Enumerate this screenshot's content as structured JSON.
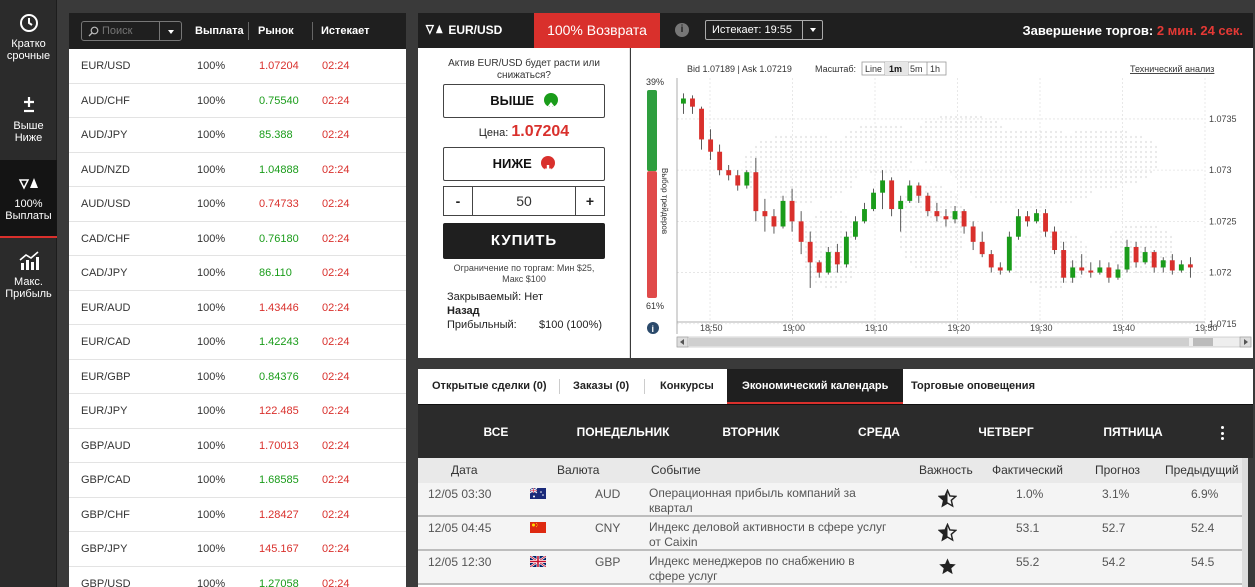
{
  "nav": [
    {
      "label": "Кратко срочные",
      "icon": "clock-icon"
    },
    {
      "label": "Выше Ниже",
      "icon": "plus-minus-icon"
    },
    {
      "label": "100% Выплаты",
      "icon": "up-down-arrows-icon"
    },
    {
      "label": "Макс. Прибыль",
      "icon": "chart-growth-icon"
    }
  ],
  "market": {
    "search_placeholder": "Поиск",
    "headers": {
      "payout": "Выплата",
      "market": "Рынок",
      "expires": "Истекает"
    },
    "rows": [
      {
        "symbol": "EUR/USD",
        "payout": "100%",
        "price": "1.07204",
        "dir": "down",
        "expires": "02:24"
      },
      {
        "symbol": "AUD/CHF",
        "payout": "100%",
        "price": "0.75540",
        "dir": "up",
        "expires": "02:24"
      },
      {
        "symbol": "AUD/JPY",
        "payout": "100%",
        "price": "85.388",
        "dir": "up",
        "expires": "02:24"
      },
      {
        "symbol": "AUD/NZD",
        "payout": "100%",
        "price": "1.04888",
        "dir": "up",
        "expires": "02:24"
      },
      {
        "symbol": "AUD/USD",
        "payout": "100%",
        "price": "0.74733",
        "dir": "down",
        "expires": "02:24"
      },
      {
        "symbol": "CAD/CHF",
        "payout": "100%",
        "price": "0.76180",
        "dir": "up",
        "expires": "02:24"
      },
      {
        "symbol": "CAD/JPY",
        "payout": "100%",
        "price": "86.110",
        "dir": "up",
        "expires": "02:24"
      },
      {
        "symbol": "EUR/AUD",
        "payout": "100%",
        "price": "1.43446",
        "dir": "down",
        "expires": "02:24"
      },
      {
        "symbol": "EUR/CAD",
        "payout": "100%",
        "price": "1.42243",
        "dir": "up",
        "expires": "02:24"
      },
      {
        "symbol": "EUR/GBP",
        "payout": "100%",
        "price": "0.84376",
        "dir": "up",
        "expires": "02:24"
      },
      {
        "symbol": "EUR/JPY",
        "payout": "100%",
        "price": "122.485",
        "dir": "down",
        "expires": "02:24"
      },
      {
        "symbol": "GBP/AUD",
        "payout": "100%",
        "price": "1.70013",
        "dir": "down",
        "expires": "02:24"
      },
      {
        "symbol": "GBP/CAD",
        "payout": "100%",
        "price": "1.68585",
        "dir": "up",
        "expires": "02:24"
      },
      {
        "symbol": "GBP/CHF",
        "payout": "100%",
        "price": "1.28427",
        "dir": "down",
        "expires": "02:24"
      },
      {
        "symbol": "GBP/JPY",
        "payout": "100%",
        "price": "145.167",
        "dir": "down",
        "expires": "02:24"
      },
      {
        "symbol": "GBP/USD",
        "payout": "100%",
        "price": "1.27058",
        "dir": "up",
        "expires": "02:24"
      }
    ]
  },
  "topbar": {
    "asset": "EUR/USD",
    "return_label": "100% Возврата",
    "info": "i",
    "expiry": "Истекает: 19:55",
    "close_label": "Завершение торгов:",
    "countdown": "2 мин. 24 сек."
  },
  "trade": {
    "question": "Актив EUR/USD будет расти или снижаться?",
    "up_label": "ВЫШЕ",
    "price_label": "Цена:",
    "price": "1.07204",
    "down_label": "НИЖЕ",
    "minus": "-",
    "amount": "50",
    "plus": "+",
    "buy_label": "КУПИТЬ",
    "limit": "Ограничение по торгам: Мин $25, Макс $100",
    "closeable": "Закрываемый: Нет",
    "direction": "Назад",
    "profit_label": "Прибыльный:",
    "profit_value": "$100 (100%)"
  },
  "chart_header": {
    "bid_ask": "Bid 1.07189 | Ask 1.07219",
    "scale_label": "Масштаб:",
    "scales": [
      "Line",
      "1m",
      "5m",
      "1h"
    ],
    "active_scale": "1m",
    "tech_link": "Технический анализ"
  },
  "sentiment": {
    "top": "39%",
    "bottom": "61%",
    "label": "Выбор трейдеров",
    "up_share": 0.39
  },
  "chart_data": {
    "type": "candlestick",
    "x_ticks": [
      "18:50",
      "19:00",
      "19:10",
      "19:20",
      "19:30",
      "19:40",
      "19:50"
    ],
    "x_range": [
      "18:46",
      "19:50"
    ],
    "y_ticks": [
      "1.0735",
      "1.073",
      "1.0725",
      "1.072",
      "1.0715"
    ],
    "ylim": [
      1.0714,
      1.0739
    ],
    "colors": {
      "up": "#1a9c1a",
      "down": "#d9302c"
    },
    "candles": [
      [
        1.07365,
        1.07375,
        1.07355,
        1.0737
      ],
      [
        1.0737,
        1.07373,
        1.07355,
        1.07362
      ],
      [
        1.0736,
        1.07362,
        1.0732,
        1.0733
      ],
      [
        1.0733,
        1.0734,
        1.0731,
        1.07318
      ],
      [
        1.07318,
        1.07325,
        1.07295,
        1.073
      ],
      [
        1.073,
        1.07305,
        1.0729,
        1.07295
      ],
      [
        1.07295,
        1.073,
        1.0728,
        1.07285
      ],
      [
        1.07285,
        1.073,
        1.07282,
        1.07298
      ],
      [
        1.07298,
        1.07312,
        1.0725,
        1.0726
      ],
      [
        1.0726,
        1.07272,
        1.0724,
        1.07255
      ],
      [
        1.07255,
        1.07262,
        1.07238,
        1.07245
      ],
      [
        1.07245,
        1.07275,
        1.07243,
        1.0727
      ],
      [
        1.0727,
        1.07282,
        1.0724,
        1.0725
      ],
      [
        1.0725,
        1.0726,
        1.07218,
        1.0723
      ],
      [
        1.0723,
        1.0724,
        1.07185,
        1.0721
      ],
      [
        1.0721,
        1.07212,
        1.07195,
        1.072
      ],
      [
        1.072,
        1.07225,
        1.07198,
        1.0722
      ],
      [
        1.0722,
        1.07228,
        1.072,
        1.07208
      ],
      [
        1.07208,
        1.0724,
        1.07205,
        1.07235
      ],
      [
        1.07235,
        1.07255,
        1.07232,
        1.0725
      ],
      [
        1.0725,
        1.07268,
        1.07248,
        1.07262
      ],
      [
        1.07262,
        1.07282,
        1.0726,
        1.07278
      ],
      [
        1.07278,
        1.073,
        1.07262,
        1.0729
      ],
      [
        1.0729,
        1.07293,
        1.07255,
        1.07262
      ],
      [
        1.07262,
        1.07275,
        1.0724,
        1.0727
      ],
      [
        1.0727,
        1.0729,
        1.07268,
        1.07285
      ],
      [
        1.07285,
        1.07288,
        1.07268,
        1.07275
      ],
      [
        1.07275,
        1.07278,
        1.07255,
        1.0726
      ],
      [
        1.0726,
        1.07268,
        1.0725,
        1.07255
      ],
      [
        1.07255,
        1.07262,
        1.07245,
        1.07252
      ],
      [
        1.07252,
        1.07265,
        1.07248,
        1.0726
      ],
      [
        1.0726,
        1.07262,
        1.07238,
        1.07245
      ],
      [
        1.07245,
        1.0725,
        1.07222,
        1.0723
      ],
      [
        1.0723,
        1.0724,
        1.07215,
        1.07218
      ],
      [
        1.07218,
        1.07222,
        1.072,
        1.07205
      ],
      [
        1.07205,
        1.0721,
        1.07198,
        1.07202
      ],
      [
        1.07202,
        1.0724,
        1.072,
        1.07235
      ],
      [
        1.07235,
        1.07262,
        1.07232,
        1.07255
      ],
      [
        1.07255,
        1.0726,
        1.07245,
        1.0725
      ],
      [
        1.0725,
        1.07262,
        1.07248,
        1.07258
      ],
      [
        1.07258,
        1.07262,
        1.07235,
        1.0724
      ],
      [
        1.0724,
        1.07245,
        1.07218,
        1.07222
      ],
      [
        1.07222,
        1.0723,
        1.0719,
        1.07195
      ],
      [
        1.07195,
        1.07212,
        1.0719,
        1.07205
      ],
      [
        1.07205,
        1.07218,
        1.07198,
        1.07202
      ],
      [
        1.07202,
        1.0721,
        1.07195,
        1.072
      ],
      [
        1.072,
        1.07212,
        1.07198,
        1.07205
      ],
      [
        1.07205,
        1.0721,
        1.0719,
        1.07195
      ],
      [
        1.07195,
        1.07208,
        1.07193,
        1.07203
      ],
      [
        1.07203,
        1.07232,
        1.072,
        1.07225
      ],
      [
        1.07225,
        1.0723,
        1.07205,
        1.0721
      ],
      [
        1.0721,
        1.07225,
        1.07208,
        1.0722
      ],
      [
        1.0722,
        1.07222,
        1.072,
        1.07205
      ],
      [
        1.07205,
        1.07215,
        1.072,
        1.07212
      ],
      [
        1.07212,
        1.07218,
        1.07198,
        1.07202
      ],
      [
        1.07202,
        1.07212,
        1.072,
        1.07208
      ],
      [
        1.07208,
        1.07215,
        1.07195,
        1.07205
      ]
    ]
  },
  "tabs": [
    {
      "label": "Открытые сделки (0)",
      "active": false
    },
    {
      "label": "Заказы (0)",
      "active": false
    },
    {
      "label": "Конкурсы",
      "active": false
    },
    {
      "label": "Экономический календарь",
      "active": true
    },
    {
      "label": "Торговые оповещения",
      "active": false
    }
  ],
  "days": [
    "ВСЕ",
    "ПОНЕДЕЛЬНИК",
    "ВТОРНИК",
    "СРЕДА",
    "ЧЕТВЕРГ",
    "ПЯТНИЦА"
  ],
  "calendar": {
    "headers": {
      "date": "Дата",
      "currency": "Валюта",
      "event": "Событие",
      "importance": "Важность",
      "actual": "Фактический",
      "forecast": "Прогноз",
      "previous": "Предыдущий"
    },
    "rows": [
      {
        "date": "12/05 03:30",
        "flag": "australia-flag-icon",
        "currency": "AUD",
        "event": "Операционная прибыль компаний за квартал",
        "importance": "half-star-icon",
        "actual": "1.0%",
        "forecast": "3.1%",
        "previous": "6.9%"
      },
      {
        "date": "12/05 04:45",
        "flag": "china-flag-icon",
        "currency": "CNY",
        "event": "Индекс деловой активности в сфере услуг от Caixin",
        "importance": "half-star-icon",
        "actual": "53.1",
        "forecast": "52.7",
        "previous": "52.4"
      },
      {
        "date": "12/05 12:30",
        "flag": "uk-flag-icon",
        "currency": "GBP",
        "event": "Индекс менеджеров по снабжению в сфере услуг",
        "importance": "full-star-icon",
        "actual": "55.2",
        "forecast": "54.2",
        "previous": "54.5"
      }
    ]
  }
}
